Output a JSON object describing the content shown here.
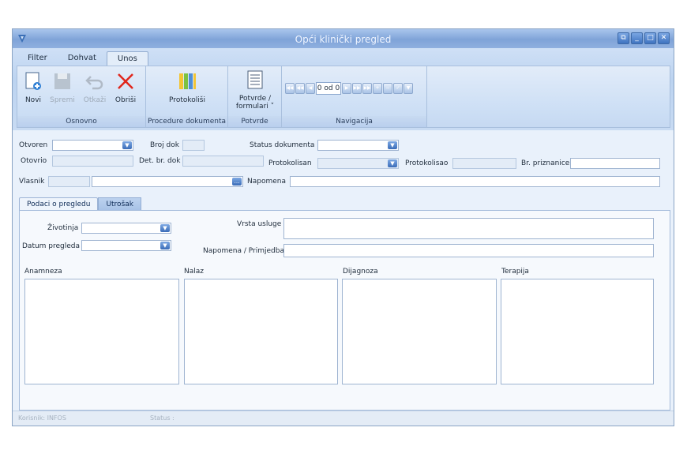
{
  "window": {
    "title": "Opći klinički pregled"
  },
  "ribbon": {
    "tabs": [
      "Filter",
      "Dohvat",
      "Unos"
    ],
    "groups": {
      "osnovno": "Osnovno",
      "procedure": "Procedure dokumenta",
      "potvrde": "Potvrde",
      "navigacija": "Navigacija"
    },
    "buttons": {
      "novi": "Novi",
      "spremi": "Spremi",
      "otkazi": "Otkaži",
      "obrisi": "Obriši",
      "protokolisi": "Protokoliši",
      "potvrde_line1": "Potvrde /",
      "potvrde_line2": "formulari ˅"
    },
    "nav_text": "0 od 0"
  },
  "form": {
    "otvoren": "Otvoren",
    "broj_dok": "Broj dok",
    "status_dokumenta": "Status dokumenta",
    "otovrio": "Otovrio",
    "det_br_dok": "Det. br. dok",
    "protokolisan": "Protokolisan",
    "protokolisao": "Protokolisao",
    "br_priznanice": "Br. priznanice",
    "vlasnik": "Vlasnik",
    "napomena": "Napomena"
  },
  "subtabs": [
    "Podaci o pregledu",
    "Utrošak"
  ],
  "exam": {
    "zivotinja": "Životinja",
    "datum_pregleda": "Datum pregleda",
    "vrsta_usluge": "Vrsta usluge",
    "napomena_primjedba": "Napomena / Primjedba",
    "anamneza": "Anamneza",
    "nalaz": "Nalaz",
    "dijagnoza": "Dijagnoza",
    "terapija": "Terapija"
  },
  "statusbar": {
    "korisnik": "Korisnik: INFOS",
    "status": "Status :"
  }
}
